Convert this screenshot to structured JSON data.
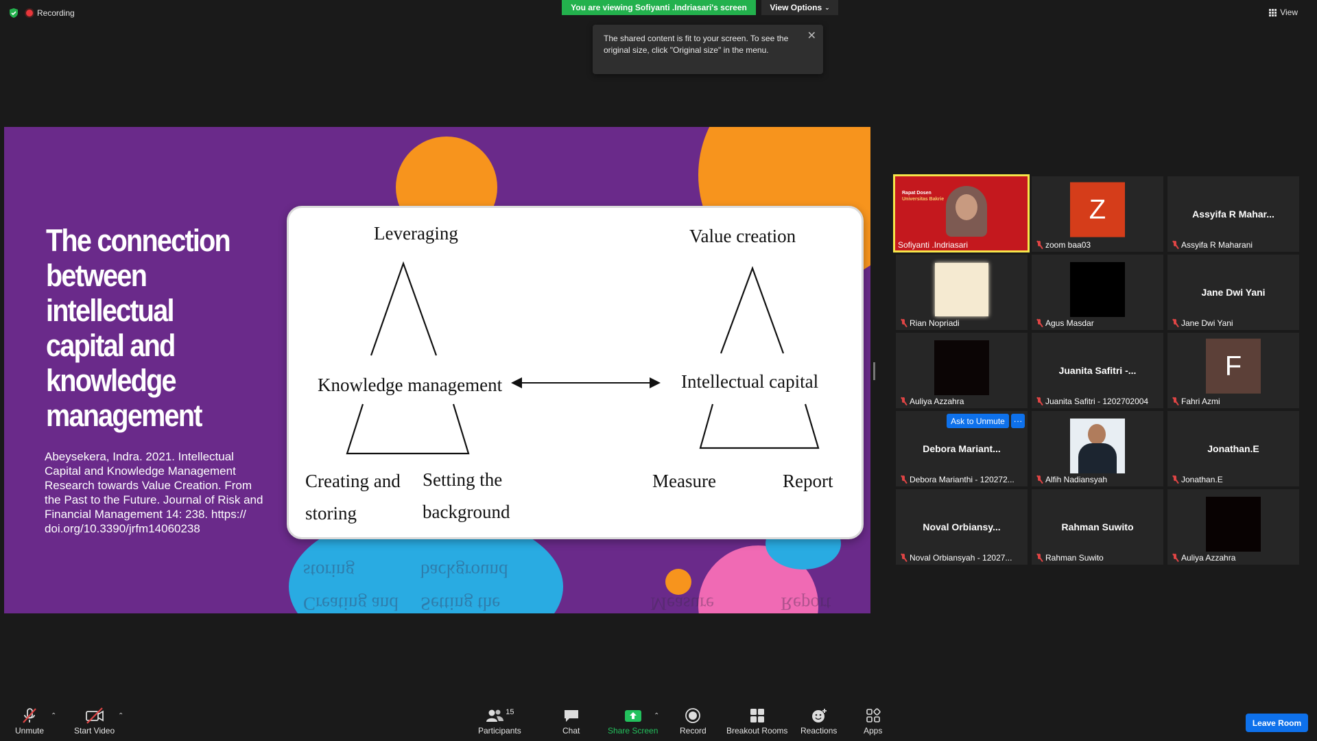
{
  "top": {
    "recording_label": "Recording",
    "viewing_banner": "You are viewing Sofiyanti .Indriasari's screen",
    "view_options_label": "View Options",
    "tooltip_text": "The shared content is fit to your screen. To see the original size, click \"Original size\" in the menu.",
    "view_label": "View"
  },
  "slide": {
    "title": "The connection between intellectual capital and knowledge management",
    "reference": "Abeysekera, Indra. 2021. Intellectual Capital and Knowledge Management Research towards Value Creation. From the Past to the Future. Journal of Risk and Financial Management 14: 238. https:// doi.org/10.3390/jrfm14060238",
    "diagram": {
      "leveraging": "Leveraging",
      "value_creation": "Value creation",
      "knowledge_management": "Knowledge management",
      "intellectual_capital": "Intellectual capital",
      "creating_and": "Creating and",
      "storing": "storing",
      "setting_the": "Setting the",
      "background": "background",
      "measure": "Measure",
      "report": "Report"
    },
    "colors": {
      "bg": "#6a2a8a",
      "orange": "#f7941d",
      "blue": "#29abe2",
      "pink": "#f06ab4"
    }
  },
  "gallery": {
    "tiles": [
      {
        "display": "",
        "label": "Sofiyanti .Indriasari",
        "muted": false,
        "active": true
      },
      {
        "display": "Z",
        "label": "zoom baa03",
        "muted": true
      },
      {
        "display": "Assyifa R Mahar...",
        "label": "Assyifa R Maharani",
        "muted": true
      },
      {
        "display": "",
        "label": "Rian Nopriadi",
        "muted": true
      },
      {
        "display": "",
        "label": "Agus Masdar",
        "muted": true
      },
      {
        "display": "Jane Dwi Yani",
        "label": "Jane Dwi Yani",
        "muted": true
      },
      {
        "display": "",
        "label": "Auliya Azzahra",
        "muted": true
      },
      {
        "display": "Juanita Safitri -...",
        "label": "Juanita Safitri - 1202702004",
        "muted": true
      },
      {
        "display": "F",
        "label": "Fahri Azmi",
        "muted": true
      },
      {
        "display": "Debora Mariant...",
        "label": "Debora Marianthi - 120272...",
        "muted": true
      },
      {
        "display": "",
        "label": "Alfih Nadiansyah",
        "muted": true
      },
      {
        "display": "Jonathan.E",
        "label": "Jonathan.E",
        "muted": true
      },
      {
        "display": "Noval Orbiansy...",
        "label": "Noval Orbiansyah - 12027...",
        "muted": true
      },
      {
        "display": "Rahman Suwito",
        "label": "Rahman Suwito",
        "muted": true
      },
      {
        "display": "",
        "label": "Auliya Azzahra",
        "muted": true
      }
    ],
    "ask_to_unmute": "Ask to Unmute",
    "more": "···",
    "active_thumb": {
      "line1": "Rapat Dosen",
      "line2": "Universitas Bakrie"
    }
  },
  "toolbar": {
    "unmute": "Unmute",
    "start_video": "Start Video",
    "participants": "Participants",
    "participants_count": "15",
    "chat": "Chat",
    "share_screen": "Share Screen",
    "record": "Record",
    "breakout_rooms": "Breakout Rooms",
    "reactions": "Reactions",
    "apps": "Apps",
    "leave_room": "Leave Room"
  },
  "icons": [
    "shield-icon",
    "recording-icon",
    "chevron-down-icon",
    "close-icon",
    "grid-icon",
    "mic-muted-icon",
    "video-off-icon",
    "participants-icon",
    "chat-icon",
    "share-screen-icon",
    "record-icon",
    "breakout-rooms-icon",
    "reactions-icon",
    "apps-icon"
  ]
}
